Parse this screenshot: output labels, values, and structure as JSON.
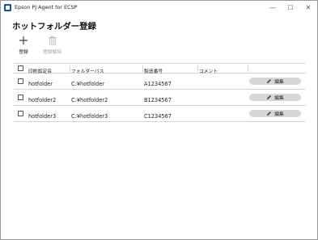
{
  "window": {
    "title": "Epson PJ Agent for ECSP",
    "controls": {
      "minimize": "—",
      "maximize": "☐",
      "close": "✕"
    }
  },
  "page": {
    "title": "ホットフォルダー登録"
  },
  "toolbar": {
    "register_label": "登録",
    "unregister_label": "登録解除",
    "register_icon": "plus-icon",
    "unregister_icon": "trash-icon",
    "unregister_enabled": false
  },
  "table": {
    "columns": {
      "name": "印刷設定名",
      "path": "フォルダーパス",
      "serial": "製造番号",
      "comment": "コメント"
    },
    "rows": [
      {
        "name": "hotfolder",
        "path": "C:¥hotfolder",
        "serial": "A1234567",
        "comment": "",
        "action": "編集"
      },
      {
        "name": "hotfolder2",
        "path": "C:¥hotfolder2",
        "serial": "B1234567",
        "comment": "",
        "action": "編集"
      },
      {
        "name": "hotfolder3",
        "path": "C:¥hotfolder3",
        "serial": "C1234567",
        "comment": "",
        "action": "編集"
      }
    ]
  },
  "colors": {
    "app_icon": "#1f4fa3",
    "edit_button_bg": "#d6d6d6",
    "disabled_text": "#a6a6a6",
    "grid_line": "#d4d4d4"
  }
}
